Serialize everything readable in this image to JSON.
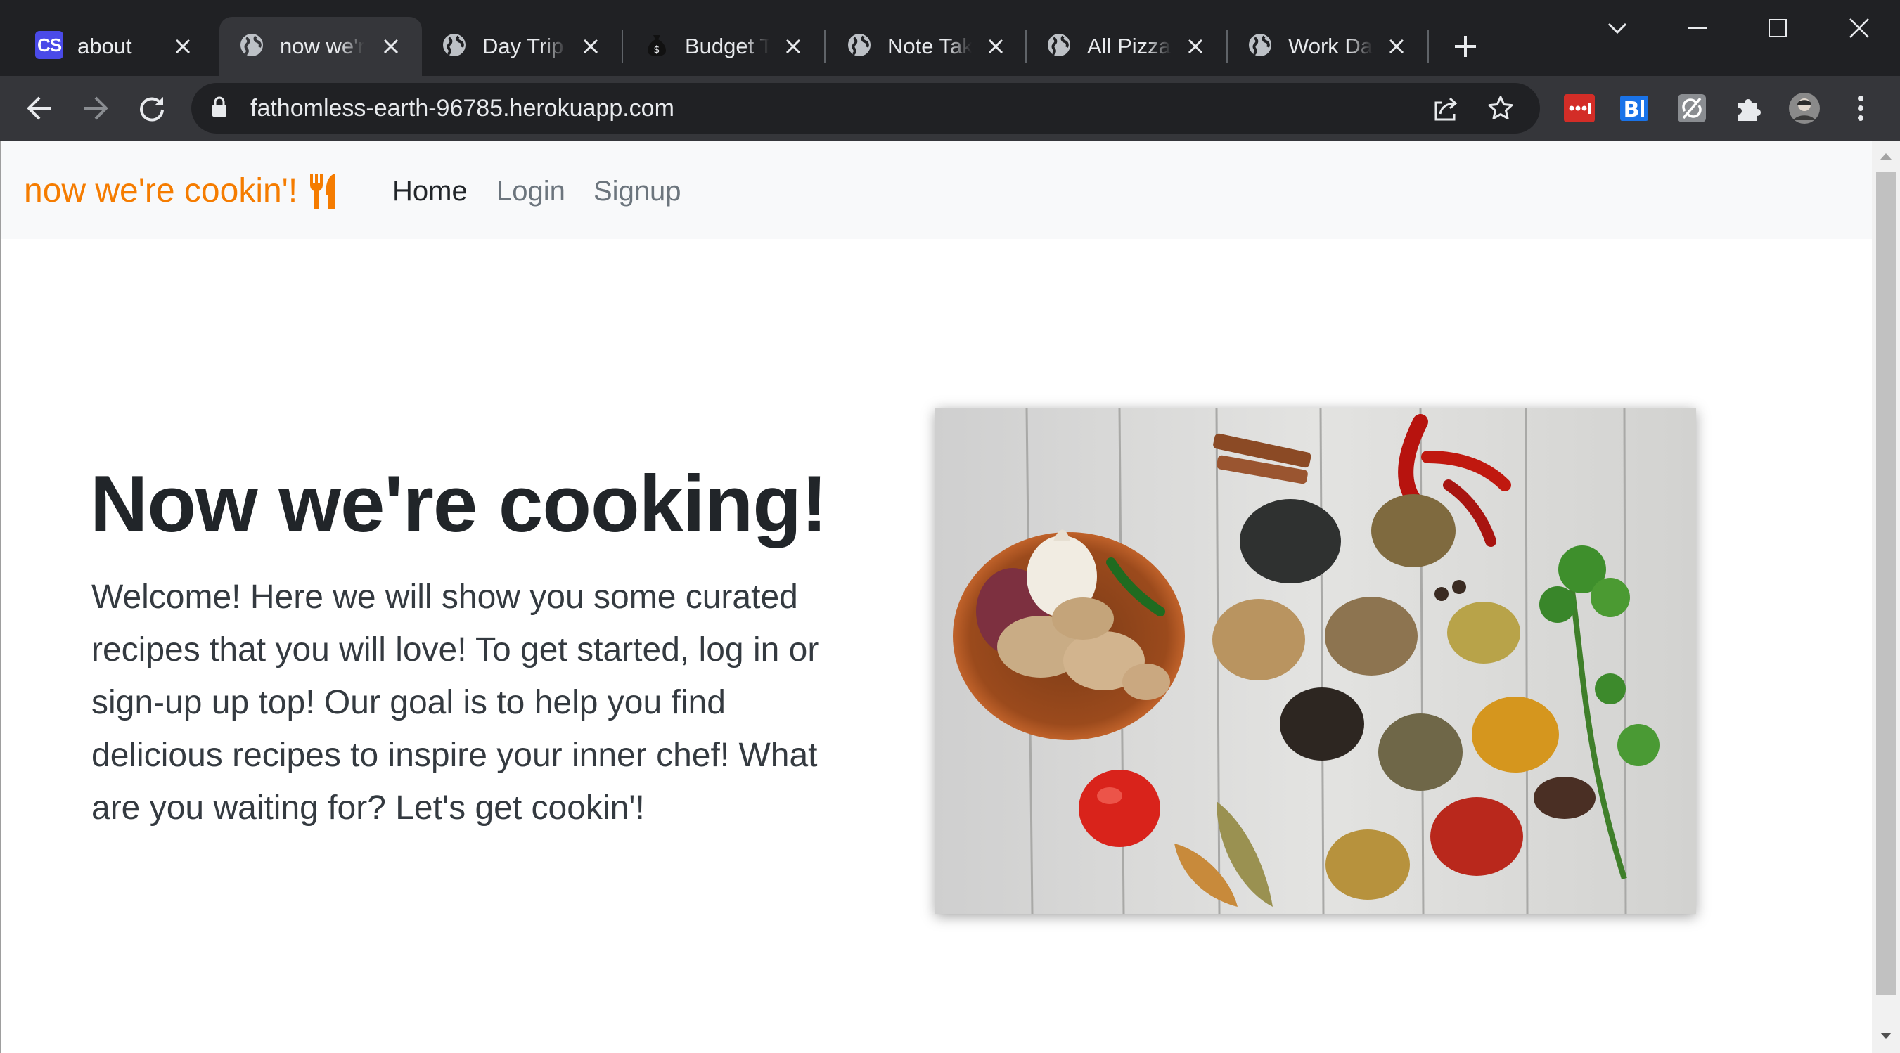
{
  "browser": {
    "tabs": [
      {
        "title": "about",
        "favicon": "cs-favicon",
        "favicon_text": "CS",
        "active": false
      },
      {
        "title": "now we're cookin'!",
        "favicon": "globe-icon",
        "active": true
      },
      {
        "title": "Day Trip Planner",
        "favicon": "globe-icon",
        "active": false
      },
      {
        "title": "Budget Tracker",
        "favicon": "money-bag-icon",
        "active": false
      },
      {
        "title": "Note Taker",
        "favicon": "globe-icon",
        "active": false
      },
      {
        "title": "All Pizzas",
        "favicon": "globe-icon",
        "active": false
      },
      {
        "title": "Work Day Scheduler",
        "favicon": "globe-icon",
        "active": false
      }
    ],
    "url": "fathomless-earth-96785.herokuapp.com"
  },
  "site": {
    "brand": "now we're cookin'!",
    "nav": [
      {
        "label": "Home",
        "active": true
      },
      {
        "label": "Login",
        "active": false
      },
      {
        "label": "Signup",
        "active": false
      }
    ]
  },
  "hero": {
    "title": "Now we're cooking!",
    "text": "Welcome! Here we will show you some curated recipes that you will love! To get started, log in or sign-up up top! Our goal is to help you find delicious recipes to inspire your inner chef! What are you waiting for? Let's get cookin'!"
  },
  "colors": {
    "brand": "#f57c00",
    "chrome_dark": "#202124",
    "chrome_toolbar": "#35363a",
    "navbar_bg": "#f8f9fa"
  }
}
